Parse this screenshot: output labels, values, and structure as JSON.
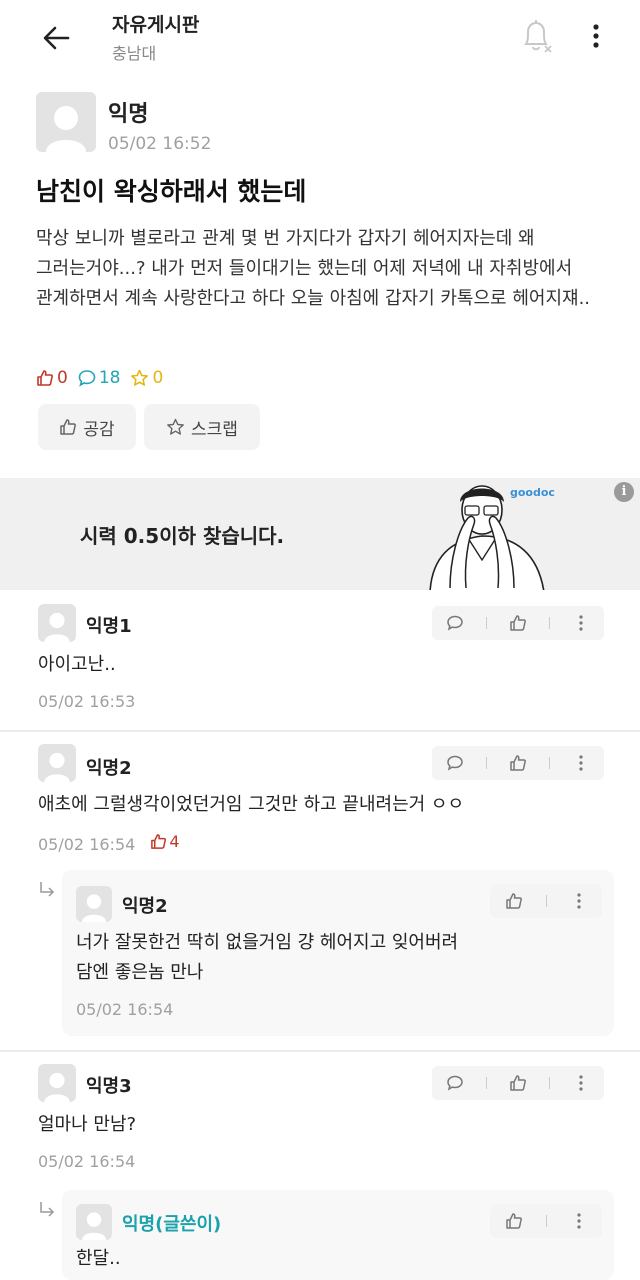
{
  "header": {
    "title": "자유게시판",
    "subtitle": "충남대",
    "back_icon": "arrow-left-icon",
    "notify_icon": "bell-off-icon",
    "more_icon": "more-vertical-icon"
  },
  "post": {
    "author": "익명",
    "time": "05/02 16:52",
    "title": "남친이 왁싱하래서 했는데",
    "body": "막상 보니까 별로라고 관계 몇 번 가지다가 갑자기 헤어지자는데 왜 그러는거야...? 내가 먼저 들이대기는 했는데 어제 저녁에 내 자취방에서 관계하면서 계속 사랑한다고 하다 오늘 아침에 갑자기 카톡으로 헤어지쟤..",
    "likes": "0",
    "comments": "18",
    "scraps": "0",
    "like_button": "공감",
    "scrap_button": "스크랩"
  },
  "ad": {
    "text": "시력 0.5이하 찾습니다.",
    "brand": "goodoc",
    "info_icon": "info-icon"
  },
  "comments": [
    {
      "author": "익명1",
      "text": "아이고난..",
      "time": "05/02 16:53"
    },
    {
      "author": "익명2",
      "text": "애초에 그럴생각이었던거임 그것만 하고 끝내려는거 ㅇㅇ",
      "time": "05/02 16:54",
      "likes": "4"
    },
    {
      "author": "익명2",
      "text_lines": [
        "너가 잘못한건 딱히 없을거임 걍 헤어지고 잊어버려",
        "담엔 좋은놈 만나"
      ],
      "time": "05/02 16:54"
    },
    {
      "author": "익명3",
      "text": "얼마나 만남?",
      "time": "05/02 16:54"
    },
    {
      "author": "익명(글쓴이)",
      "text": "한달.."
    }
  ],
  "colors": {
    "like_red": "#c0392b",
    "comment_teal": "#22a6b3",
    "scrap_yellow": "#e2b60c",
    "writer_teal": "#1aa2ac",
    "muted_gray": "#a0a0a0"
  }
}
